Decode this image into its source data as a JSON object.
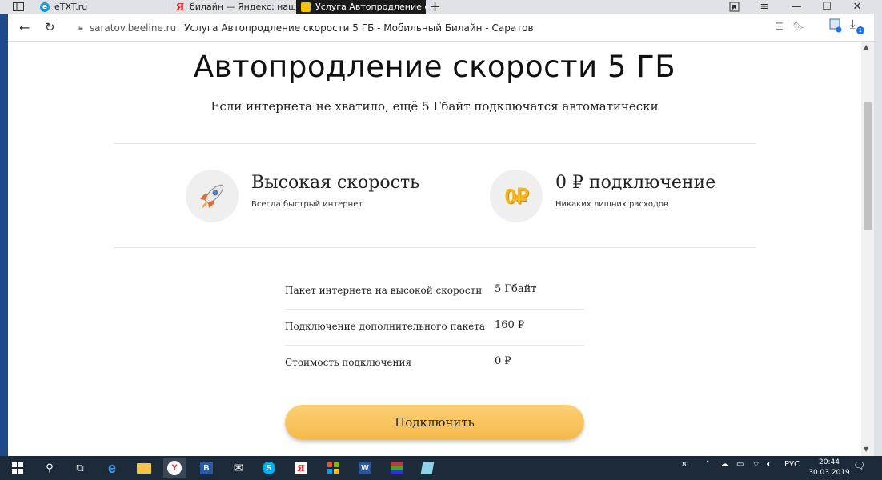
{
  "browser": {
    "tabs": [
      {
        "label": "eTXT.ru",
        "icon": "etxt-favicon"
      },
      {
        "label": "билайн — Яндекс: нашлос",
        "icon": "yandex-favicon"
      },
      {
        "label": "Услуга Автопродление с",
        "icon": "beeline-favicon"
      }
    ],
    "address": {
      "domain": "saratov.beeline.ru",
      "title": "Услуга Автопродление скорости 5 ГБ - Мобильный Билайн - Саратов"
    },
    "download_badge": "1"
  },
  "page": {
    "heading": "Автопродление скорости 5 ГБ",
    "subheading": "Если интернета не хватило, ещё 5 Гбайт подключатся автоматически",
    "features": [
      {
        "title": "Высокая скорость",
        "desc": "Всегда быстрый интернет",
        "icon": "rocket-icon"
      },
      {
        "title": "0 ₽ подключение",
        "desc": "Никаких лишних расходов",
        "icon": "coin-icon",
        "icon_text": "0₽"
      }
    ],
    "table": [
      {
        "label": "Пакет интернета на высокой скорости",
        "value": "5 Гбайт"
      },
      {
        "label": "Подключение дополнительного пакета",
        "value": "160 ₽"
      },
      {
        "label": "Стоимость подключения",
        "value": "0 ₽"
      }
    ],
    "cta_label": "Подключить"
  },
  "taskbar": {
    "language": "РУС",
    "time": "20:44",
    "date": "30.03.2019"
  },
  "colors": {
    "accent": "#f6b94c",
    "coin": "#f5b51c"
  }
}
